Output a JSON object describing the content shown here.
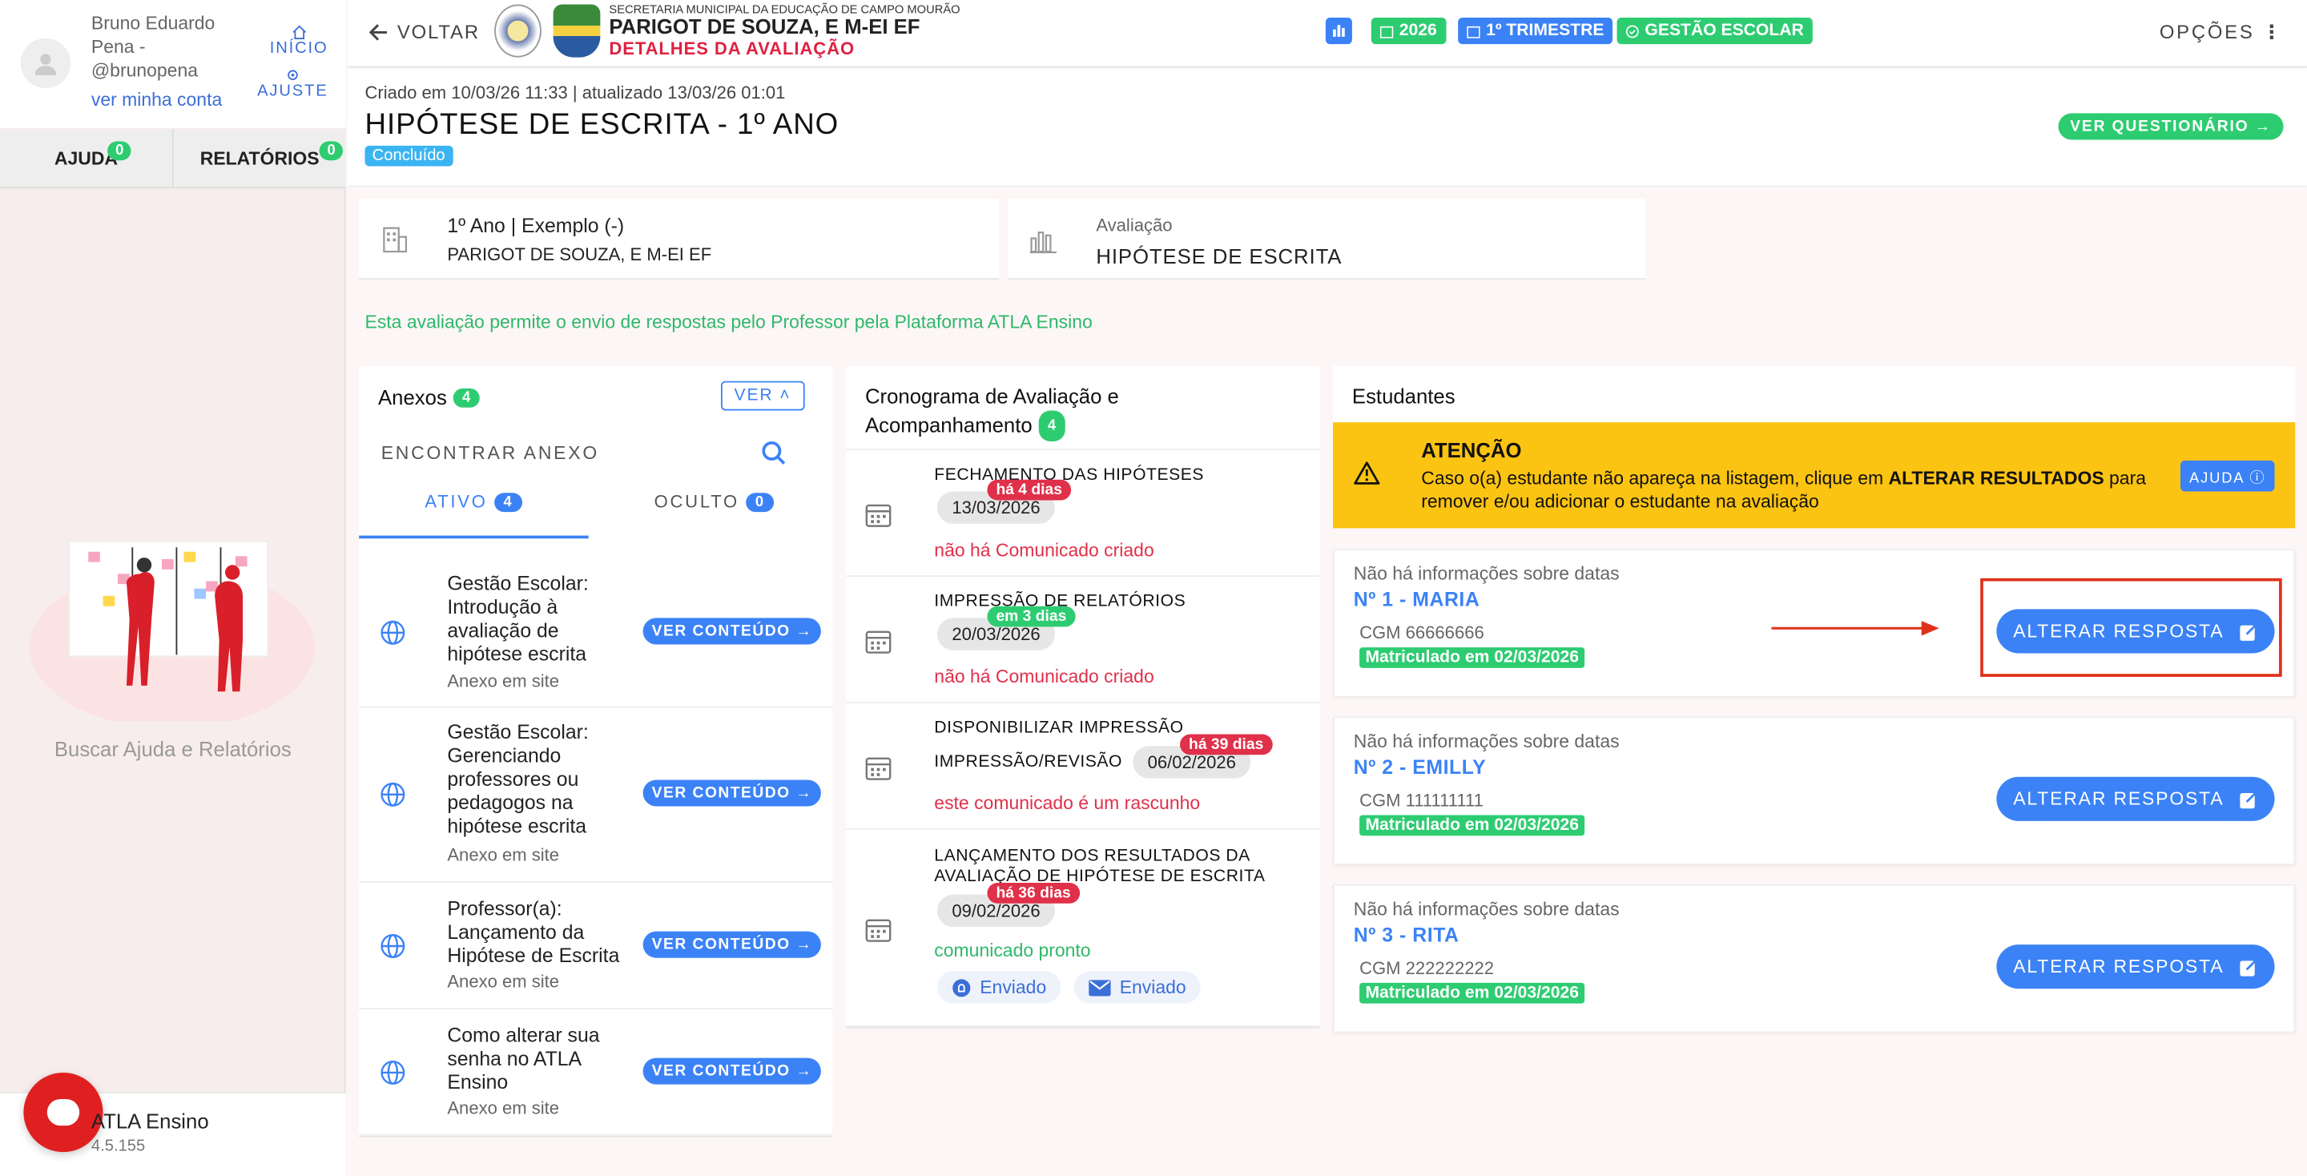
{
  "sidebar": {
    "user_name": "Bruno Eduardo Pena - @brunopena",
    "account_link": "ver minha conta",
    "nav_home": "INÍCIO",
    "nav_settings": "AJUSTE",
    "tab_help": "AJUDA",
    "tab_help_count": "0",
    "tab_reports": "RELATÓRIOS",
    "tab_reports_count": "0",
    "help_text": "Buscar Ajuda e Relatórios",
    "footer_title": "ATLA Ensino",
    "footer_version": "4.5.155"
  },
  "topbar": {
    "back": "VOLTAR",
    "secretaria": "SECRETARIA MUNICIPAL DA EDUCAÇÃO DE CAMPO MOURÃO",
    "school": "PARIGOT DE SOUZA, E M-EI EF",
    "section": "DETALHES DA AVALIAÇÃO",
    "year": "2026",
    "term": "1º TRIMESTRE",
    "mgmt": "GESTÃO ESCOLAR",
    "options": "OPÇÕES"
  },
  "header": {
    "meta": "Criado em 10/03/26 11:33 | atualizado 13/03/26 01:01",
    "title": "HIPÓTESE DE ESCRITA - 1º ANO",
    "status": "Concluído",
    "questionnaire_btn": "VER QUESTIONÁRIO"
  },
  "info": {
    "class": "1º Ano | Exemplo (-)",
    "school": "PARIGOT DE SOUZA, E M-EI EF",
    "eval_label": "Avaliação",
    "eval_name": "HIPÓTESE DE ESCRITA"
  },
  "note": "Esta avaliação permite o envio de respostas pelo Professor pela Plataforma ATLA Ensino",
  "anexos": {
    "title": "Anexos",
    "count": "4",
    "ver": "VER",
    "search_placeholder": "ENCONTRAR ANEXO",
    "tab_active": "ATIVO",
    "tab_active_count": "4",
    "tab_hidden": "OCULTO",
    "tab_hidden_count": "0",
    "btn": "VER CONTEÚDO",
    "items": [
      {
        "title": "Gestão Escolar: Introdução à avaliação de hipótese escrita",
        "sub": "Anexo em site"
      },
      {
        "title": "Gestão Escolar: Gerenciando professores ou pedagogos na hipótese escrita",
        "sub": "Anexo em site"
      },
      {
        "title": "Professor(a): Lançamento da Hipótese de Escrita",
        "sub": "Anexo em site"
      },
      {
        "title": "Como alterar sua senha no ATLA Ensino",
        "sub": "Anexo em site"
      }
    ]
  },
  "cronograma": {
    "title": "Cronograma de Avaliação e Acompanhamento",
    "count": "4",
    "items": [
      {
        "title": "FECHAMENTO DAS HIPÓTESES",
        "badge": "há 4 dias",
        "date": "13/03/2026",
        "status": "não há Comunicado criado"
      },
      {
        "title": "IMPRESSÃO DE RELATÓRIOS",
        "badge": "em 3 dias",
        "date": "20/03/2026",
        "status": "não há Comunicado criado"
      },
      {
        "title": "DISPONIBILIZAR IMPRESSÃO",
        "title2": "IMPRESSÃO/REVISÃO",
        "badge": "há 39 dias",
        "date": "06/02/2026",
        "status": "este comunicado é um rascunho"
      },
      {
        "title": "LANÇAMENTO DOS RESULTADOS DA AVALIAÇÃO DE HIPÓTESE DE ESCRITA",
        "badge": "há 36 dias",
        "date": "09/02/2026",
        "status": "comunicado pronto",
        "sent1": "Enviado",
        "sent2": "Enviado"
      }
    ]
  },
  "estudantes": {
    "title": "Estudantes",
    "warn_title": "ATENÇÃO",
    "warn_text_1": "Caso o(a) estudante não apareça na listagem, clique em ",
    "warn_text_bold": "ALTERAR RESULTADOS",
    "warn_text_2": " para remover e/ou adicionar o estudante na avaliação",
    "warn_help": "AJUDA",
    "btn": "ALTERAR RESPOSTA",
    "list": [
      {
        "nodate": "Não há informações sobre datas",
        "name": "Nº 1 - MARIA",
        "cgm": "CGM 66666666",
        "enrolled": "Matriculado em 02/03/2026"
      },
      {
        "nodate": "Não há informações sobre datas",
        "name": "Nº 2 - EMILLY",
        "cgm": "CGM 111111111",
        "enrolled": "Matriculado em 02/03/2026"
      },
      {
        "nodate": "Não há informações sobre datas",
        "name": "Nº 3 - RITA",
        "cgm": "CGM 222222222",
        "enrolled": "Matriculado em 02/03/2026"
      }
    ]
  },
  "colors": {
    "accent": "#3b82f6",
    "success": "#2ecc71",
    "danger": "#e0304a",
    "warning": "#fbc312"
  }
}
